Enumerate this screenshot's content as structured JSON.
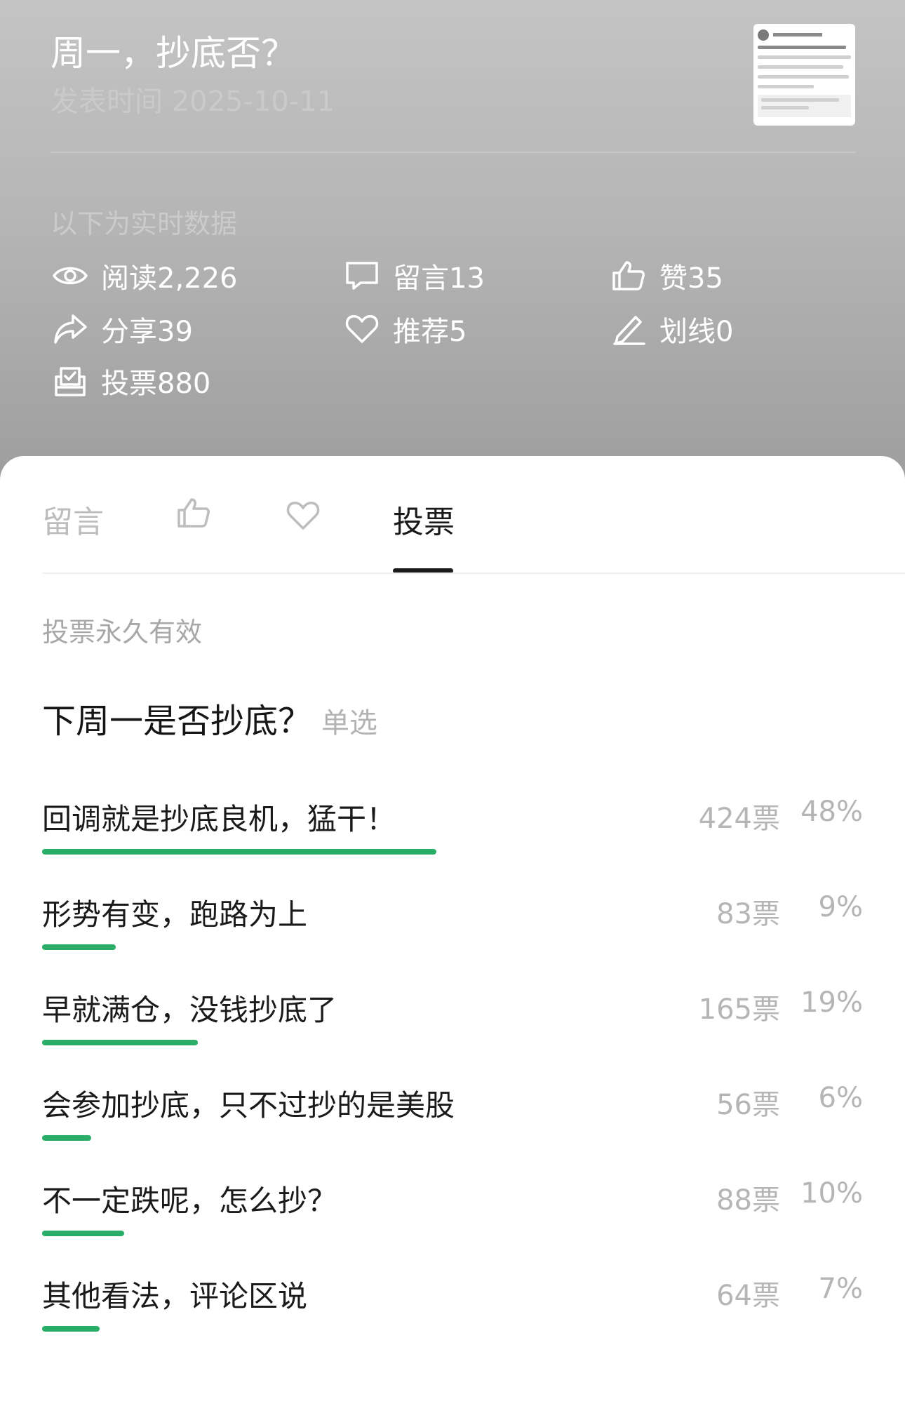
{
  "header": {
    "title": "周一，抄底否？",
    "publish_time": "发表时间 2025-10-11",
    "realtime_label": "以下为实时数据",
    "stats": [
      {
        "icon": "eye-icon",
        "label": "阅读2,226"
      },
      {
        "icon": "comment-icon",
        "label": "留言13"
      },
      {
        "icon": "thumbs-up-icon",
        "label": "赞35"
      },
      {
        "icon": "share-icon",
        "label": "分享39"
      },
      {
        "icon": "heart-icon",
        "label": "推荐5"
      },
      {
        "icon": "pen-icon",
        "label": "划线0"
      },
      {
        "icon": "vote-icon",
        "label": "投票880"
      }
    ]
  },
  "tabs": {
    "comments": "留言",
    "likes_icon": "thumbs-up-icon",
    "recommend_icon": "heart-icon",
    "vote": "投票"
  },
  "poll": {
    "validity": "投票永久有效",
    "question": "下周一是否抄底？",
    "mode": "单选",
    "bar_color": "#2aae67",
    "options": [
      {
        "label": "回调就是抄底良机，猛干！",
        "votes": "424票",
        "percent": "48%",
        "fraction": 0.48
      },
      {
        "label": "形势有变，跑路为上",
        "votes": "83票",
        "percent": "9%",
        "fraction": 0.09
      },
      {
        "label": "早就满仓，没钱抄底了",
        "votes": "165票",
        "percent": "19%",
        "fraction": 0.19
      },
      {
        "label": "会参加抄底，只不过抄的是美股",
        "votes": "56票",
        "percent": "6%",
        "fraction": 0.06
      },
      {
        "label": "不一定跌呢，怎么抄？",
        "votes": "88票",
        "percent": "10%",
        "fraction": 0.1
      },
      {
        "label": "其他看法，评论区说",
        "votes": "64票",
        "percent": "7%",
        "fraction": 0.07
      }
    ]
  }
}
